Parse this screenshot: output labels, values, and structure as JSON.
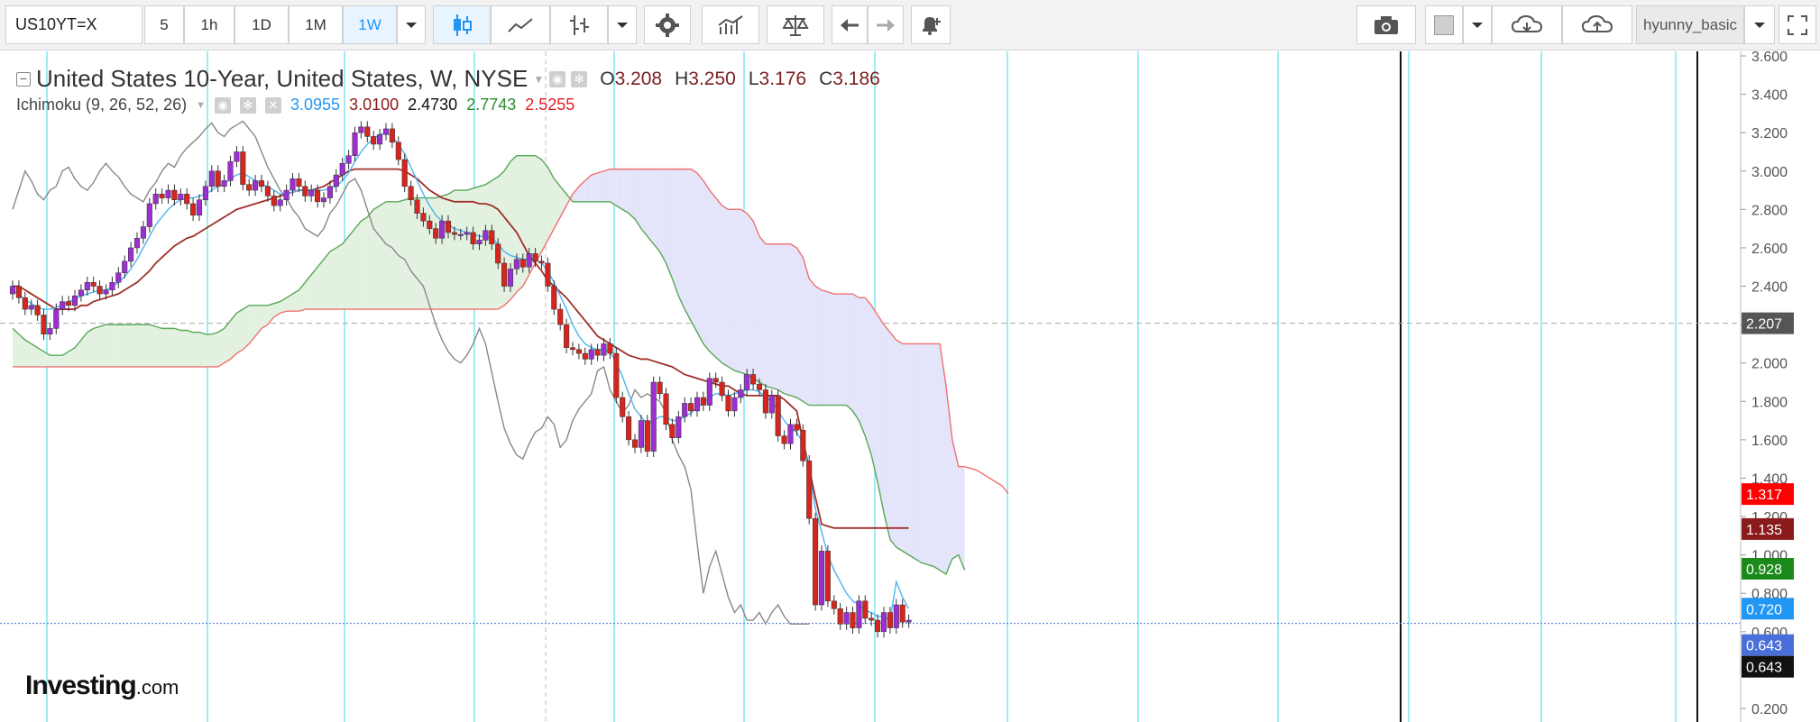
{
  "toolbar": {
    "symbol": "US10YT=X",
    "intervals": [
      "5",
      "1h",
      "1D",
      "1M",
      "1W"
    ],
    "active_interval": "1W",
    "user": "hyunny_basic"
  },
  "legend": {
    "title": "United States 10-Year, United States, W, NYSE",
    "open_label": "O",
    "open": "3.208",
    "high_label": "H",
    "high": "3.250",
    "low_label": "L",
    "low": "3.176",
    "close_label": "C",
    "close": "3.186",
    "indicator": "Ichimoku (9, 26, 52, 26)",
    "ichimoku_values": [
      "3.0955",
      "3.0100",
      "2.4730",
      "2.7743",
      "2.5255"
    ],
    "ichimoku_colors": [
      "#2196f3",
      "#8b1a1a",
      "#111111",
      "#2e8b2e",
      "#e0202a"
    ]
  },
  "watermark": {
    "brand": "Investing",
    "suffix": ".com"
  },
  "colors": {
    "up_candle": "#9b2fd1",
    "down_candle": "#d4261e",
    "tenkan": "#4fb3f0",
    "kijun": "#a0302a",
    "chikou": "#888888",
    "span_a": "#58a858",
    "span_b": "#f07070",
    "cloud_bull": "#e3f1e0",
    "cloud_bear": "#e4e4fb",
    "vline": "#7fe6f0"
  },
  "chart_data": {
    "type": "candlestick",
    "title": "United States 10-Year, United States, W, NYSE",
    "ylim": [
      0.2,
      3.6
    ],
    "y_ticks": [
      "0.200",
      "0.400",
      "0.600",
      "0.800",
      "1.000",
      "1.200",
      "1.400",
      "1.600",
      "1.800",
      "2.000",
      "2.200",
      "2.400",
      "2.600",
      "2.800",
      "3.000",
      "3.200",
      "3.400",
      "3.600"
    ],
    "grid": false,
    "price_line": 2.207,
    "price_labels": [
      {
        "value": 2.207,
        "text": "2.207",
        "color": "#555555"
      },
      {
        "value": 1.317,
        "text": "1.317",
        "color": "#ff0000"
      },
      {
        "value": 1.135,
        "text": "1.135",
        "color": "#8b1a1a"
      },
      {
        "value": 0.928,
        "text": "0.928",
        "color": "#1a8a1a"
      },
      {
        "value": 0.72,
        "text": "0.720",
        "color": "#2196f3"
      },
      {
        "value": 0.643,
        "text": "0.643",
        "color": "#4a6fd8"
      },
      {
        "value": 0.643,
        "text": "0.643",
        "color": "#111111"
      }
    ],
    "candles": {
      "start_index": 0,
      "close": [
        2.4,
        2.34,
        2.28,
        2.3,
        2.25,
        2.15,
        2.18,
        2.28,
        2.32,
        2.3,
        2.35,
        2.38,
        2.42,
        2.4,
        2.36,
        2.38,
        2.42,
        2.47,
        2.53,
        2.6,
        2.65,
        2.71,
        2.83,
        2.88,
        2.86,
        2.9,
        2.85,
        2.88,
        2.83,
        2.77,
        2.85,
        2.92,
        3.0,
        2.92,
        2.95,
        3.05,
        3.1,
        2.93,
        2.9,
        2.95,
        2.92,
        2.87,
        2.82,
        2.85,
        2.9,
        2.96,
        2.92,
        2.87,
        2.9,
        2.84,
        2.86,
        2.92,
        2.98,
        3.04,
        3.08,
        3.2,
        3.23,
        3.18,
        3.14,
        3.19,
        3.22,
        3.15,
        3.06,
        2.92,
        2.85,
        2.78,
        2.74,
        2.7,
        2.65,
        2.74,
        2.68,
        2.67,
        2.67,
        2.68,
        2.62,
        2.64,
        2.69,
        2.62,
        2.52,
        2.4,
        2.49,
        2.54,
        2.5,
        2.57,
        2.53,
        2.52,
        2.4,
        2.28,
        2.2,
        2.08,
        2.07,
        2.05,
        2.02,
        2.07,
        2.04,
        2.1,
        2.05,
        1.82,
        1.72,
        1.6,
        1.56,
        1.7,
        1.54,
        1.9,
        1.84,
        1.68,
        1.61,
        1.72,
        1.79,
        1.75,
        1.82,
        1.78,
        1.92,
        1.9,
        1.83,
        1.75,
        1.82,
        1.86,
        1.94,
        1.89,
        1.86,
        1.74,
        1.83,
        1.62,
        1.58,
        1.68,
        1.65,
        1.49,
        1.19,
        0.74,
        1.02,
        0.76,
        0.72,
        0.64,
        0.7,
        0.62,
        0.76,
        0.67,
        0.66,
        0.6,
        0.7,
        0.62,
        0.74,
        0.65,
        0.66
      ],
      "open": [
        2.36,
        2.4,
        2.34,
        2.28,
        2.3,
        2.25,
        2.15,
        2.18,
        2.28,
        2.32,
        2.3,
        2.35,
        2.38,
        2.42,
        2.4,
        2.36,
        2.38,
        2.42,
        2.47,
        2.53,
        2.6,
        2.65,
        2.71,
        2.83,
        2.88,
        2.86,
        2.9,
        2.85,
        2.88,
        2.83,
        2.77,
        2.85,
        2.92,
        3.0,
        2.92,
        2.95,
        3.05,
        3.1,
        2.93,
        2.9,
        2.95,
        2.92,
        2.87,
        2.82,
        2.85,
        2.9,
        2.96,
        2.92,
        2.87,
        2.9,
        2.84,
        2.86,
        2.92,
        2.98,
        3.04,
        3.08,
        3.2,
        3.23,
        3.18,
        3.14,
        3.19,
        3.22,
        3.15,
        3.06,
        2.92,
        2.85,
        2.78,
        2.74,
        2.7,
        2.65,
        2.74,
        2.68,
        2.67,
        2.67,
        2.68,
        2.62,
        2.64,
        2.69,
        2.62,
        2.52,
        2.4,
        2.49,
        2.54,
        2.5,
        2.57,
        2.53,
        2.52,
        2.4,
        2.28,
        2.2,
        2.08,
        2.07,
        2.05,
        2.02,
        2.07,
        2.04,
        2.1,
        2.05,
        1.82,
        1.72,
        1.6,
        1.56,
        1.7,
        1.54,
        1.9,
        1.84,
        1.68,
        1.61,
        1.72,
        1.79,
        1.75,
        1.82,
        1.78,
        1.92,
        1.9,
        1.83,
        1.75,
        1.82,
        1.86,
        1.94,
        1.89,
        1.86,
        1.74,
        1.83,
        1.62,
        1.58,
        1.68,
        1.65,
        1.49,
        1.19,
        0.74,
        1.02,
        0.76,
        0.72,
        0.64,
        0.7,
        0.62,
        0.76,
        0.67,
        0.66,
        0.6,
        0.7,
        0.62,
        0.74,
        0.65
      ]
    },
    "tenkan": [
      2.38,
      2.36,
      2.33,
      2.31,
      2.29,
      2.28,
      2.28,
      2.29,
      2.3,
      2.32,
      2.33,
      2.35,
      2.36,
      2.37,
      2.38,
      2.38,
      2.4,
      2.42,
      2.45,
      2.49,
      2.54,
      2.6,
      2.66,
      2.72,
      2.76,
      2.8,
      2.83,
      2.85,
      2.86,
      2.86,
      2.87,
      2.88,
      2.9,
      2.92,
      2.93,
      2.96,
      2.98,
      2.99,
      2.97,
      2.95,
      2.93,
      2.92,
      2.9,
      2.88,
      2.88,
      2.89,
      2.9,
      2.9,
      2.9,
      2.9,
      2.9,
      2.91,
      2.92,
      2.95,
      2.99,
      3.05,
      3.1,
      3.14,
      3.17,
      3.19,
      3.2,
      3.18,
      3.14,
      3.09,
      3.02,
      2.95,
      2.88,
      2.82,
      2.77,
      2.74,
      2.72,
      2.7,
      2.69,
      2.68,
      2.67,
      2.66,
      2.66,
      2.65,
      2.62,
      2.58,
      2.56,
      2.55,
      2.54,
      2.54,
      2.54,
      2.52,
      2.48,
      2.42,
      2.35,
      2.28,
      2.2,
      2.14,
      2.1,
      2.08,
      2.07,
      2.07,
      2.06,
      2.0,
      1.93,
      1.84,
      1.76,
      1.72,
      1.68,
      1.7,
      1.72,
      1.72,
      1.7,
      1.7,
      1.72,
      1.74,
      1.77,
      1.79,
      1.82,
      1.84,
      1.84,
      1.83,
      1.84,
      1.85,
      1.86,
      1.86,
      1.85,
      1.82,
      1.8,
      1.75,
      1.7,
      1.66,
      1.64,
      1.58,
      1.44,
      1.24,
      1.12,
      1.0,
      0.92,
      0.86,
      0.8,
      0.76,
      0.74,
      0.71,
      0.7,
      0.68,
      0.68,
      0.66,
      0.86,
      0.78,
      0.72
    ],
    "kijun": [
      2.4,
      2.4,
      2.38,
      2.36,
      2.34,
      2.32,
      2.3,
      2.28,
      2.28,
      2.28,
      2.28,
      2.3,
      2.3,
      2.32,
      2.33,
      2.34,
      2.35,
      2.36,
      2.38,
      2.4,
      2.42,
      2.45,
      2.48,
      2.52,
      2.55,
      2.58,
      2.61,
      2.63,
      2.65,
      2.66,
      2.68,
      2.7,
      2.72,
      2.74,
      2.76,
      2.78,
      2.8,
      2.81,
      2.82,
      2.83,
      2.84,
      2.85,
      2.86,
      2.87,
      2.88,
      2.89,
      2.9,
      2.9,
      2.9,
      2.91,
      2.92,
      2.94,
      2.96,
      2.98,
      3.0,
      3.01,
      3.01,
      3.01,
      3.01,
      3.01,
      3.01,
      3.01,
      3.01,
      3.0,
      2.98,
      2.96,
      2.93,
      2.9,
      2.88,
      2.86,
      2.85,
      2.84,
      2.84,
      2.84,
      2.84,
      2.83,
      2.83,
      2.82,
      2.8,
      2.76,
      2.72,
      2.68,
      2.62,
      2.56,
      2.52,
      2.48,
      2.43,
      2.4,
      2.37,
      2.34,
      2.3,
      2.26,
      2.22,
      2.18,
      2.14,
      2.12,
      2.1,
      2.08,
      2.06,
      2.04,
      2.03,
      2.02,
      2.02,
      2.01,
      2.0,
      1.99,
      1.98,
      1.96,
      1.94,
      1.93,
      1.92,
      1.91,
      1.9,
      1.89,
      1.88,
      1.88,
      1.86,
      1.84,
      1.83,
      1.83,
      1.83,
      1.83,
      1.83,
      1.83,
      1.81,
      1.78,
      1.75,
      1.6,
      1.45,
      1.3,
      1.16,
      1.15,
      1.14,
      1.14,
      1.14,
      1.14,
      1.14,
      1.14,
      1.14,
      1.14,
      1.14,
      1.14,
      1.14,
      1.14,
      1.14
    ],
    "chikou": [
      2.8,
      2.9,
      3.0,
      2.95,
      2.88,
      2.85,
      2.9,
      2.92,
      3.0,
      3.02,
      2.96,
      2.92,
      2.9,
      2.94,
      3.0,
      3.04,
      3.0,
      2.97,
      2.92,
      2.88,
      2.86,
      2.84,
      2.9,
      2.94,
      3.0,
      3.04,
      3.02,
      3.08,
      3.12,
      3.15,
      3.18,
      3.22,
      3.25,
      3.2,
      3.18,
      3.22,
      3.24,
      3.26,
      3.22,
      3.18,
      3.1,
      3.02,
      2.96,
      2.9,
      2.86,
      2.8,
      2.76,
      2.7,
      2.68,
      2.66,
      2.7,
      2.78,
      2.82,
      2.88,
      2.94,
      2.96,
      2.9,
      2.8,
      2.7,
      2.66,
      2.62,
      2.6,
      2.56,
      2.54,
      2.48,
      2.44,
      2.4,
      2.3,
      2.2,
      2.12,
      2.06,
      2.02,
      2.0,
      2.04,
      2.1,
      2.18,
      2.1,
      1.95,
      1.8,
      1.66,
      1.58,
      1.52,
      1.5,
      1.58,
      1.64,
      1.66,
      1.72,
      1.68,
      1.56,
      1.6,
      1.7,
      1.76,
      1.8,
      1.84,
      1.96,
      1.98,
      1.86,
      1.8,
      1.74,
      1.78,
      1.86,
      1.82,
      1.84,
      1.82,
      1.8,
      1.74,
      1.6,
      1.52,
      1.46,
      1.34,
      1.06,
      0.8,
      0.94,
      1.02,
      0.9,
      0.78,
      0.7,
      0.74,
      0.66,
      0.66,
      0.7,
      0.64,
      0.7,
      0.74,
      0.68,
      0.64,
      0.64,
      0.64,
      0.64
    ],
    "span_a": [
      2.18,
      2.15,
      2.12,
      2.1,
      2.08,
      2.06,
      2.04,
      2.04,
      2.04,
      2.06,
      2.08,
      2.12,
      2.16,
      2.18,
      2.19,
      2.2,
      2.2,
      2.2,
      2.2,
      2.2,
      2.2,
      2.2,
      2.2,
      2.19,
      2.18,
      2.18,
      2.18,
      2.17,
      2.17,
      2.16,
      2.16,
      2.15,
      2.15,
      2.16,
      2.18,
      2.22,
      2.26,
      2.28,
      2.3,
      2.3,
      2.3,
      2.3,
      2.31,
      2.32,
      2.34,
      2.36,
      2.38,
      2.42,
      2.46,
      2.5,
      2.54,
      2.58,
      2.6,
      2.62,
      2.66,
      2.7,
      2.74,
      2.76,
      2.8,
      2.82,
      2.84,
      2.84,
      2.84,
      2.85,
      2.86,
      2.86,
      2.86,
      2.86,
      2.86,
      2.87,
      2.88,
      2.9,
      2.9,
      2.9,
      2.91,
      2.92,
      2.93,
      2.95,
      2.97,
      3.0,
      3.05,
      3.08,
      3.08,
      3.08,
      3.08,
      3.06,
      3.02,
      2.96,
      2.92,
      2.88,
      2.84,
      2.84,
      2.84,
      2.84,
      2.84,
      2.84,
      2.84,
      2.82,
      2.8,
      2.78,
      2.75,
      2.7,
      2.66,
      2.62,
      2.58,
      2.52,
      2.44,
      2.35,
      2.28,
      2.22,
      2.16,
      2.1,
      2.06,
      2.03,
      2.0,
      1.98,
      1.96,
      1.95,
      1.94,
      1.92,
      1.9,
      1.88,
      1.87,
      1.86,
      1.84,
      1.83,
      1.82,
      1.8,
      1.78,
      1.78,
      1.78,
      1.78,
      1.78,
      1.78,
      1.78,
      1.75,
      1.7,
      1.62,
      1.52,
      1.38,
      1.22,
      1.08,
      1.04,
      1.02,
      1.0,
      0.98,
      0.96,
      0.95,
      0.94,
      0.92,
      0.9,
      0.98,
      1.0,
      0.92
    ],
    "span_b": [
      1.98,
      1.98,
      1.98,
      1.98,
      1.98,
      1.98,
      1.98,
      1.98,
      1.98,
      1.98,
      1.98,
      1.98,
      1.98,
      1.98,
      1.98,
      1.98,
      1.98,
      1.98,
      1.98,
      1.98,
      1.98,
      1.98,
      1.98,
      1.98,
      1.98,
      1.98,
      1.98,
      1.98,
      1.98,
      1.98,
      1.98,
      1.98,
      1.98,
      1.98,
      2.0,
      2.02,
      2.05,
      2.07,
      2.1,
      2.14,
      2.18,
      2.2,
      2.24,
      2.26,
      2.27,
      2.27,
      2.27,
      2.28,
      2.28,
      2.28,
      2.28,
      2.28,
      2.28,
      2.28,
      2.28,
      2.28,
      2.28,
      2.28,
      2.28,
      2.28,
      2.28,
      2.28,
      2.28,
      2.28,
      2.28,
      2.28,
      2.28,
      2.28,
      2.28,
      2.28,
      2.28,
      2.28,
      2.28,
      2.28,
      2.28,
      2.28,
      2.28,
      2.28,
      2.28,
      2.3,
      2.33,
      2.37,
      2.4,
      2.46,
      2.52,
      2.58,
      2.64,
      2.7,
      2.76,
      2.82,
      2.88,
      2.92,
      2.95,
      2.98,
      2.99,
      3.0,
      3.01,
      3.01,
      3.01,
      3.01,
      3.01,
      3.01,
      3.01,
      3.01,
      3.01,
      3.01,
      3.01,
      3.01,
      3.01,
      3.01,
      2.99,
      2.95,
      2.9,
      2.86,
      2.82,
      2.8,
      2.8,
      2.8,
      2.78,
      2.74,
      2.66,
      2.62,
      2.62,
      2.62,
      2.62,
      2.62,
      2.6,
      2.55,
      2.44,
      2.4,
      2.38,
      2.37,
      2.36,
      2.36,
      2.36,
      2.36,
      2.34,
      2.34,
      2.3,
      2.25,
      2.2,
      2.16,
      2.12,
      2.1,
      2.1,
      2.1,
      2.1,
      2.1,
      2.1,
      2.1,
      1.88,
      1.6,
      1.46,
      1.46,
      1.45,
      1.44,
      1.42,
      1.4,
      1.38,
      1.36,
      1.32
    ],
    "span_x_start": 0
  }
}
